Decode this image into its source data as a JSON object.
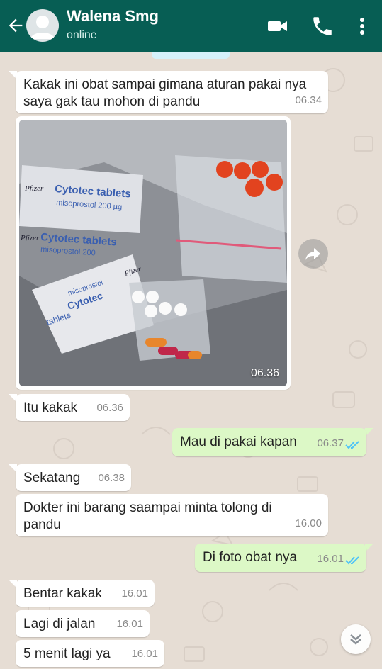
{
  "header": {
    "contact_name": "Walena Smg",
    "status": "online",
    "icons": {
      "back": "arrow-left-icon",
      "avatar": "default-avatar-icon",
      "video": "video-call-icon",
      "call": "phone-call-icon",
      "menu": "more-vertical-icon"
    },
    "bg_color": "#075e54"
  },
  "messages": [
    {
      "dir": "in",
      "text_line1": "Kakak ini obat sampai gimana aturan pakai nya",
      "text_line2": "saya gak tau mohon di pandu",
      "time": "06.34"
    },
    {
      "dir": "in",
      "type": "photo",
      "time": "06.36",
      "photo_labels": [
        "Cytotec tablets",
        "misoprostol 200 µg",
        "Cytotec tablets",
        "misoprostol 200",
        "Pfizer",
        "Pfizer",
        "Cytotec",
        "misoprostol",
        "tablets",
        "Pfizer"
      ]
    },
    {
      "dir": "in",
      "text": "Itu kakak",
      "time": "06.36"
    },
    {
      "dir": "out",
      "text": "Mau di pakai kapan",
      "time": "06.37",
      "read": true
    },
    {
      "dir": "in",
      "text": "Sekatang",
      "time": "06.38"
    },
    {
      "dir": "in",
      "text_line1": "Dokter ini barang saampai minta tolong di",
      "text_line2": "pandu",
      "time": "16.00"
    },
    {
      "dir": "out",
      "text": "Di foto obat nya",
      "time": "16.01",
      "read": true
    },
    {
      "dir": "in",
      "text": "Bentar kakak",
      "time": "16.01"
    },
    {
      "dir": "in",
      "text": "Lagi di jalan",
      "time": "16.01"
    },
    {
      "dir": "in",
      "text": "5 menit lagi ya",
      "time": "16.01"
    }
  ],
  "colors": {
    "chat_bg": "#e6ddd4",
    "outgoing_bubble": "#dcf8c6",
    "incoming_bubble": "#ffffff",
    "read_tick": "#4fc3f7"
  }
}
